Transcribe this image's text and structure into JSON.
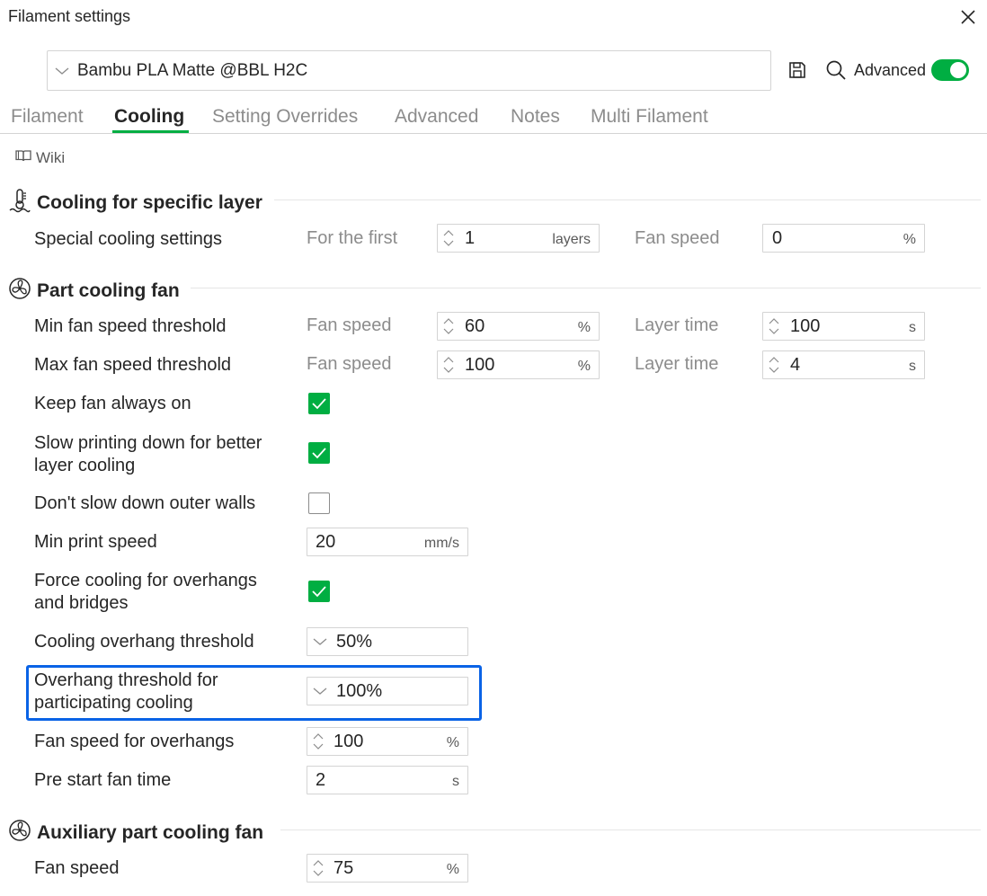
{
  "window": {
    "title": "Filament settings"
  },
  "preset": {
    "name": "Bambu PLA Matte @BBL H2C"
  },
  "toolbar": {
    "advanced_label": "Advanced",
    "advanced_on": true
  },
  "tabs": [
    {
      "label": "Filament",
      "active": false
    },
    {
      "label": "Cooling",
      "active": true
    },
    {
      "label": "Setting Overrides",
      "active": false
    },
    {
      "label": "Advanced",
      "active": false
    },
    {
      "label": "Notes",
      "active": false
    },
    {
      "label": "Multi Filament",
      "active": false
    }
  ],
  "wiki": {
    "label": "Wiki"
  },
  "sections": {
    "specific_layer": {
      "title": "Cooling for specific layer",
      "special": {
        "label": "Special cooling settings",
        "first_label": "For the first",
        "layers_value": "1",
        "layers_unit": "layers",
        "fan_label": "Fan speed",
        "fan_value": "0",
        "fan_unit": "%"
      }
    },
    "part_fan": {
      "title": "Part cooling fan",
      "min_threshold": {
        "label": "Min fan speed threshold",
        "fan_label": "Fan speed",
        "fan_value": "60",
        "fan_unit": "%",
        "time_label": "Layer time",
        "time_value": "100",
        "time_unit": "s"
      },
      "max_threshold": {
        "label": "Max fan speed threshold",
        "fan_label": "Fan speed",
        "fan_value": "100",
        "fan_unit": "%",
        "time_label": "Layer time",
        "time_value": "4",
        "time_unit": "s"
      },
      "keep_on": {
        "label": "Keep fan always on",
        "checked": true
      },
      "slow_down": {
        "label_line1": "Slow printing down for better",
        "label_line2": "layer cooling",
        "checked": true
      },
      "no_slow_outer": {
        "label": "Don't slow down outer walls",
        "checked": false
      },
      "min_speed": {
        "label": "Min print speed",
        "value": "20",
        "unit": "mm/s"
      },
      "force_cooling": {
        "label_line1": "Force cooling for overhangs",
        "label_line2": "and bridges",
        "checked": true
      },
      "overhang_threshold": {
        "label": "Cooling overhang threshold",
        "value": "50%"
      },
      "participating": {
        "label_line1": "Overhang threshold for",
        "label_line2": "participating cooling",
        "value": "100%"
      },
      "overhang_fan": {
        "label": "Fan speed for overhangs",
        "value": "100",
        "unit": "%"
      },
      "pre_start": {
        "label": "Pre start fan time",
        "value": "2",
        "unit": "s"
      }
    },
    "aux_fan": {
      "title": "Auxiliary part cooling fan",
      "fan": {
        "label": "Fan speed",
        "value": "75",
        "unit": "%"
      }
    }
  },
  "colors": {
    "accent": "#00ae42",
    "highlight": "#0a63e6"
  }
}
